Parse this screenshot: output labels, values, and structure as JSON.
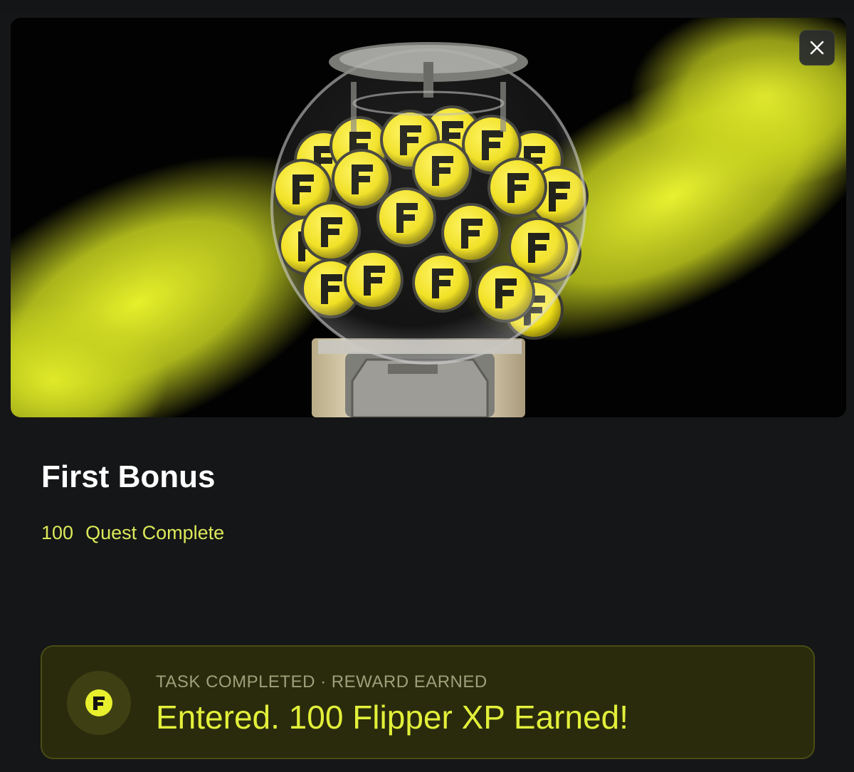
{
  "modal": {
    "title": "First Bonus",
    "close_icon": "close-icon",
    "hero_image": "gumball-machine-with-f-token-balls"
  },
  "quest": {
    "amount": "100",
    "status": "Quest Complete"
  },
  "reward": {
    "icon": "flipper-f-logo-icon",
    "caption": "TASK COMPLETED · REWARD EARNED",
    "message": "Entered. 100 Flipper XP Earned!"
  },
  "colors": {
    "background": "#151617",
    "accent": "#E2F03A",
    "card_background": "#2A2B0C",
    "token_yellow": "#F2E61E"
  }
}
